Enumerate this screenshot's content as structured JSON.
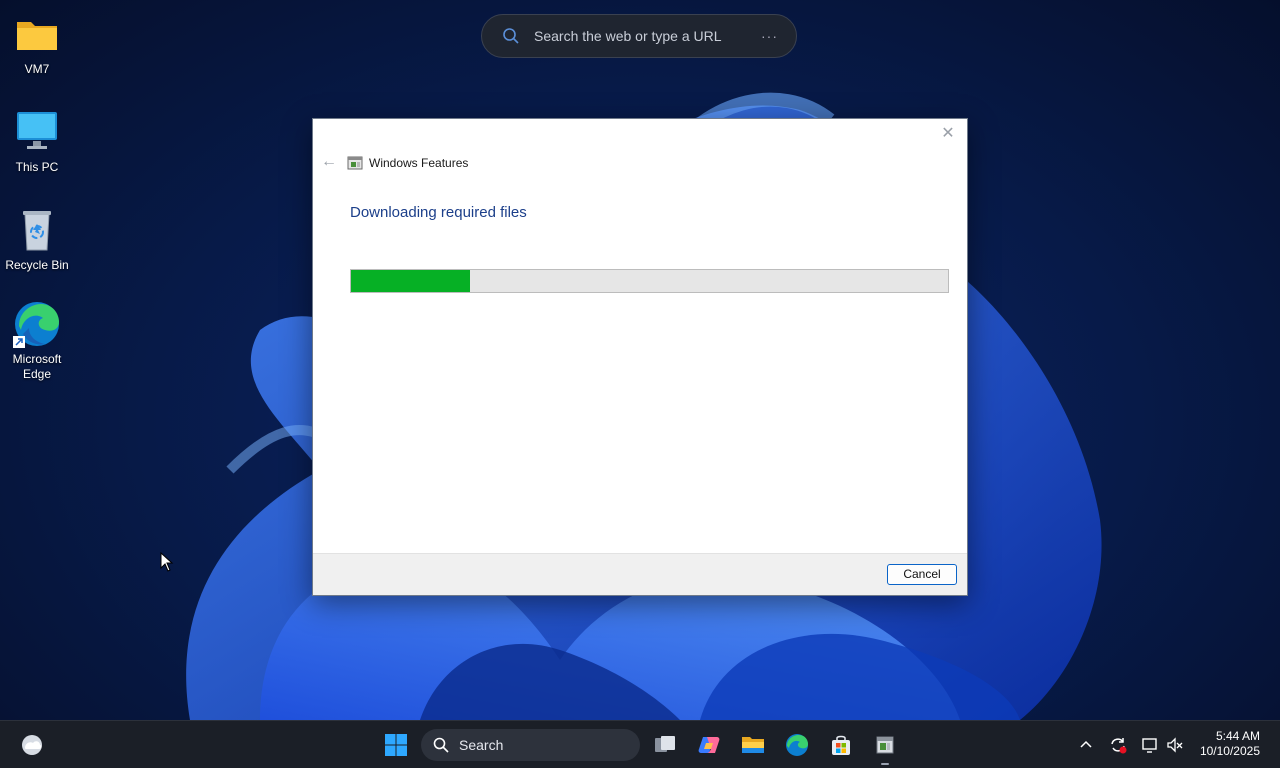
{
  "desktop": {
    "icons": [
      {
        "label": "VM7",
        "icon": "folder-icon"
      },
      {
        "label": "This PC",
        "icon": "monitor-icon"
      },
      {
        "label": "Recycle Bin",
        "icon": "recycle-bin-icon"
      },
      {
        "label": "Microsoft Edge",
        "icon": "edge-icon"
      }
    ],
    "search_bar": {
      "placeholder": "Search the web or type a URL",
      "more": "···"
    }
  },
  "dialog": {
    "title": "Windows Features",
    "heading": "Downloading required files",
    "progress_fraction": 0.2,
    "progress_color": "#06b025",
    "cancel_label": "Cancel",
    "close_glyph": "✕",
    "back_glyph": "←"
  },
  "taskbar": {
    "search_label": "Search",
    "apps": [
      "widgets-icon",
      "start-icon",
      "task-view-icon",
      "copilot-icon",
      "file-explorer-icon",
      "edge-icon",
      "store-icon",
      "windows-features-icon"
    ],
    "tray": {
      "chevron": "⌃"
    },
    "clock": {
      "time": "5:44 AM",
      "date": "10/10/2025"
    }
  }
}
